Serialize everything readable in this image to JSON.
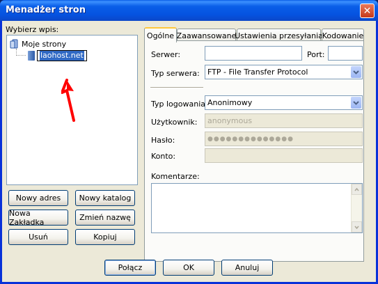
{
  "window": {
    "title": "Menadżer stron",
    "close_symbol": "✕"
  },
  "left": {
    "label": "Wybierz wpis:",
    "tree": {
      "root_label": "Moje strony",
      "child_label": "laohost.net"
    },
    "buttons": {
      "new_address": "Nowy adres",
      "new_folder": "Nowy katalog",
      "new_bookmark": "Nowa Zakładka",
      "rename": "Zmień nazwę",
      "delete": "Usuń",
      "copy": "Kopiuj"
    }
  },
  "tabs": [
    {
      "label": "Ogólne"
    },
    {
      "label": "Zaawansowane"
    },
    {
      "label": "Ustawienia przesyłania"
    },
    {
      "label": "Kodowanie"
    }
  ],
  "general": {
    "server_label": "Serwer:",
    "server_value": "",
    "port_label": "Port:",
    "port_value": "",
    "server_type_label": "Typ serwera:",
    "server_type_value": "FTP - File Transfer Protocol",
    "login_type_label": "Typ logowania:",
    "login_type_value": "Anonimowy",
    "user_label": "Użytkownik:",
    "user_value": "anonymous",
    "password_label": "Hasło:",
    "password_value": "●●●●●●●●●●●●●●",
    "account_label": "Konto:",
    "account_value": "",
    "comments_label": "Komentarze:",
    "comments_value": ""
  },
  "footer": {
    "connect": "Połącz",
    "ok": "OK",
    "cancel": "Anuluj"
  },
  "colors": {
    "title_bar": "#0a5fe8",
    "selection": "#316ac5",
    "annotation_arrow": "#ff0000"
  },
  "icons": {
    "tree_root": "folder-icon",
    "tree_child": "site-icon",
    "dropdown": "chevron-down-icon",
    "close": "close-icon"
  }
}
